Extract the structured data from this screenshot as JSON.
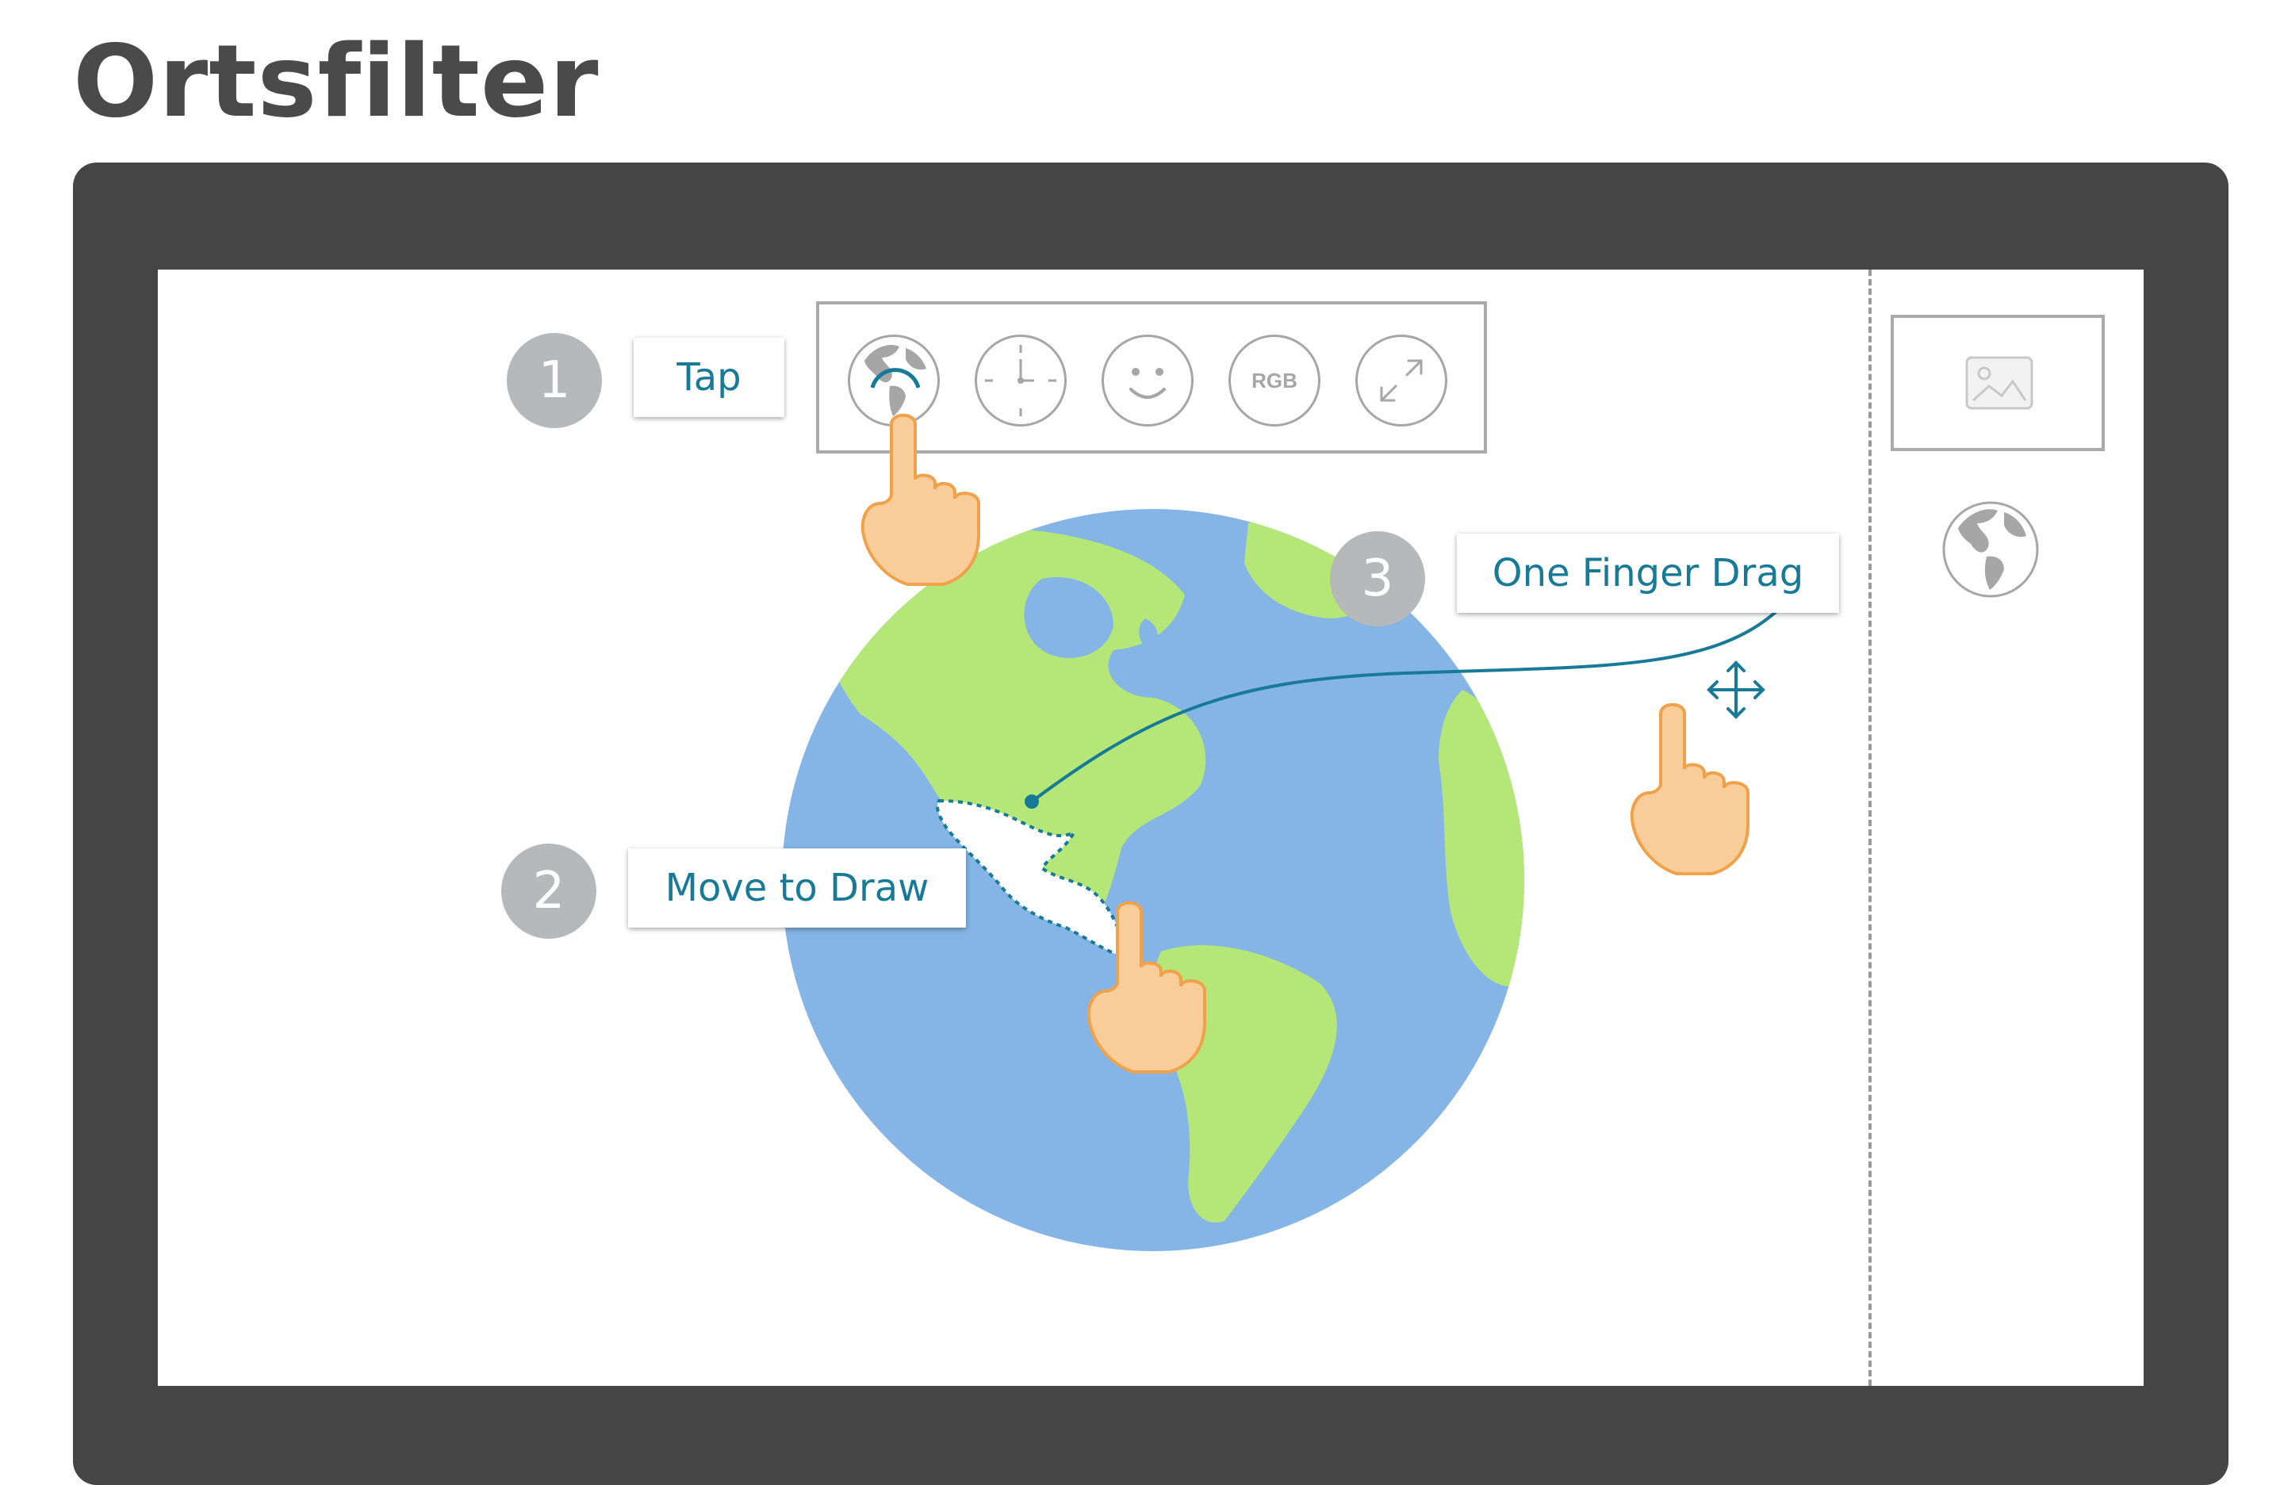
{
  "page": {
    "title": "Ortsfilter"
  },
  "toolbar": {
    "tools": [
      {
        "name": "location-filter",
        "icon": "globe-icon",
        "active": true
      },
      {
        "name": "time-filter",
        "icon": "clock-icon"
      },
      {
        "name": "face-filter",
        "icon": "smiley-icon"
      },
      {
        "name": "color-filter",
        "icon": "rgb-icon",
        "label": "RGB"
      },
      {
        "name": "fullscreen",
        "icon": "expand-icon"
      }
    ]
  },
  "steps": [
    {
      "number": "1",
      "label": "Tap"
    },
    {
      "number": "2",
      "label": "Move to Draw"
    },
    {
      "number": "3",
      "label": "One Finger Drag"
    }
  ],
  "sidebar": {
    "thumbnail_icon": "image-icon",
    "dropped_filter_icon": "globe-icon"
  },
  "colors": {
    "accent": "#177a96",
    "ocean": "#84b5e6",
    "land": "#b4e678",
    "badge": "#b7b8ba",
    "frame": "#454545",
    "hand": "#f8cd9a",
    "hand_outline": "#f0a24a"
  }
}
